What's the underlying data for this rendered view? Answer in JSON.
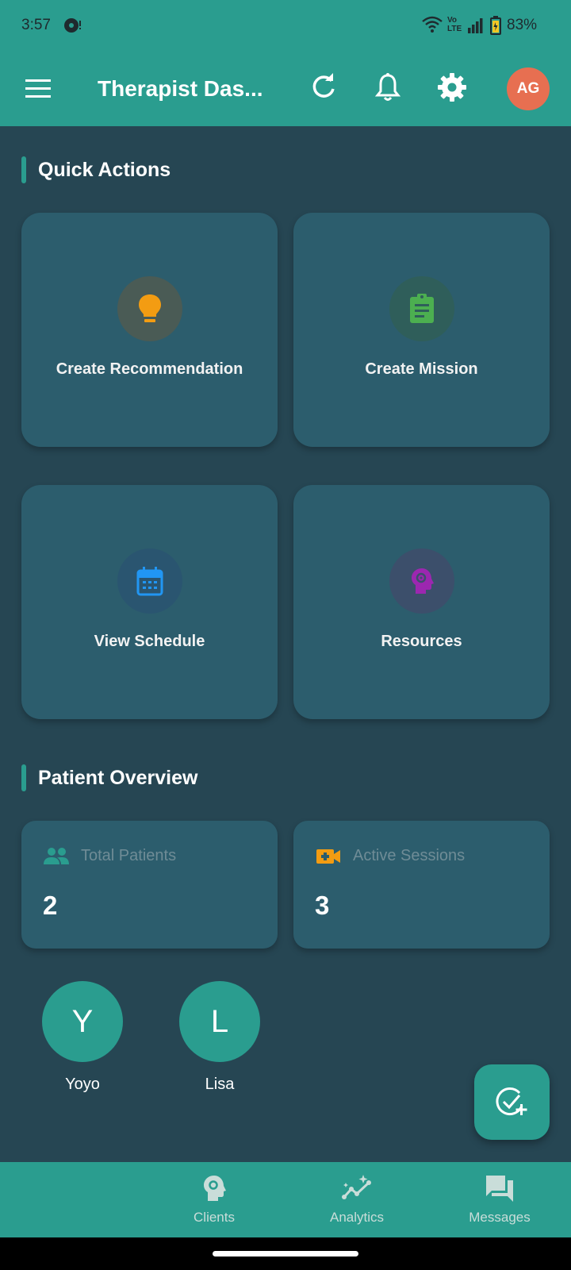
{
  "status_bar": {
    "time": "3:57",
    "volte_top": "Vo",
    "volte_bottom": "LTE",
    "battery_percent": "83%"
  },
  "app_bar": {
    "title": "Therapist Das...",
    "avatar_initials": "AG",
    "icons": [
      "menu-icon",
      "refresh-icon",
      "bell-icon",
      "gear-icon"
    ],
    "avatar_color": "#e76f51"
  },
  "quick_actions": {
    "title": "Quick Actions",
    "cards": [
      {
        "label": "Create Recommendation",
        "icon": "lightbulb-icon",
        "color": "#f39c12"
      },
      {
        "label": "Create Mission",
        "icon": "clipboard-icon",
        "color": "#4caf50"
      },
      {
        "label": "View Schedule",
        "icon": "calendar-icon",
        "color": "#2196f3"
      },
      {
        "label": "Resources",
        "icon": "brain-head-icon",
        "color": "#9c27b0"
      }
    ]
  },
  "patient_overview": {
    "title": "Patient Overview",
    "stats": [
      {
        "label": "Total Patients",
        "value": "2",
        "icon": "people-icon"
      },
      {
        "label": "Active Sessions",
        "value": "3",
        "icon": "video-add-icon"
      }
    ],
    "patients": [
      {
        "initial": "Y",
        "name": "Yoyo"
      },
      {
        "initial": "L",
        "name": "Lisa"
      }
    ]
  },
  "fab": {
    "icon": "check-add-icon"
  },
  "bottom_nav": {
    "items": [
      {
        "label": "Clients",
        "icon": "brain-head-icon"
      },
      {
        "label": "Analytics",
        "icon": "analytics-icon"
      },
      {
        "label": "Messages",
        "icon": "chat-icon"
      }
    ]
  },
  "colors": {
    "primary": "#2a9d8f",
    "background": "#264653",
    "card": "#2c5d6d"
  }
}
